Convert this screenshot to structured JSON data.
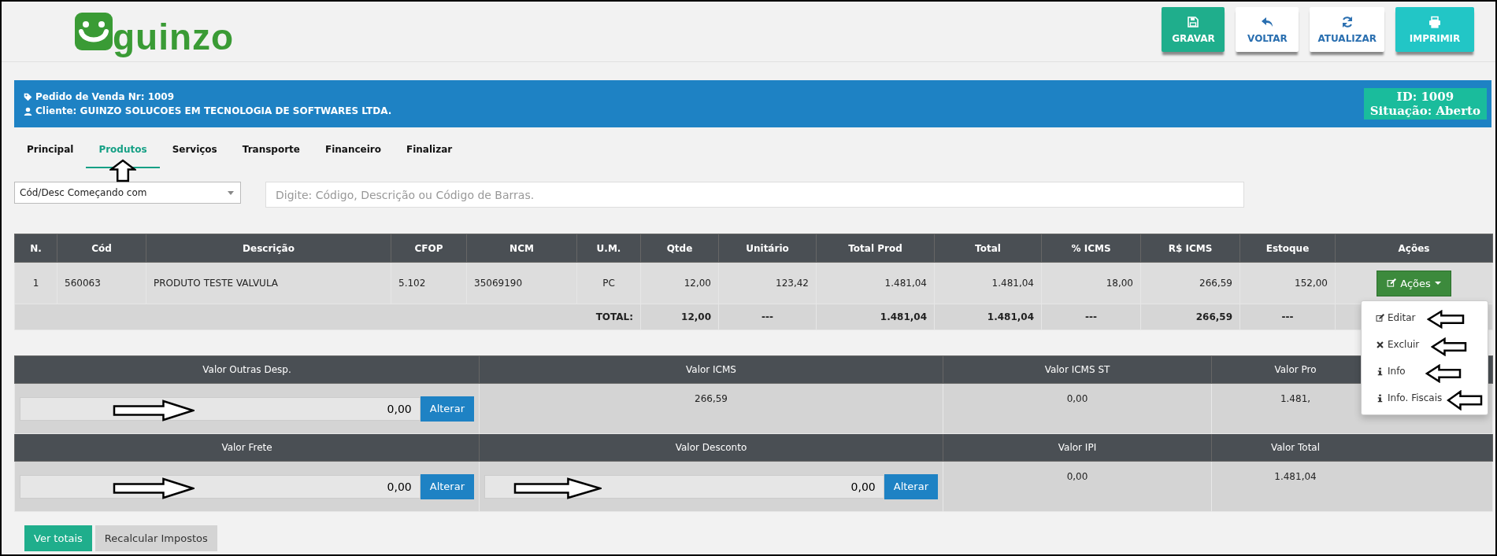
{
  "logo": {
    "text": "guinzo"
  },
  "toolbar": [
    {
      "label": "GRAVAR",
      "kind": "save"
    },
    {
      "label": "VOLTAR",
      "kind": "back"
    },
    {
      "label": "ATUALIZAR",
      "kind": "refresh"
    },
    {
      "label": "IMPRIMIR",
      "kind": "print"
    }
  ],
  "order_bar": {
    "title": "Pedido de Venda Nr: 1009",
    "client": "Cliente: GUINZO SOLUCOES EM TECNOLOGIA DE SOFTWARES LTDA.",
    "id": "ID: 1009",
    "status": "Situação: Aberto"
  },
  "tabs": [
    {
      "label": "Principal",
      "selected": false
    },
    {
      "label": "Produtos",
      "selected": true
    },
    {
      "label": "Serviços",
      "selected": false
    },
    {
      "label": "Transporte",
      "selected": false
    },
    {
      "label": "Financeiro",
      "selected": false
    },
    {
      "label": "Finalizar",
      "selected": false
    }
  ],
  "search": {
    "filter": "Cód/Desc Começando com",
    "placeholder": "Digite: Código, Descrição ou Código de Barras."
  },
  "table": {
    "columns": [
      "N.",
      "Cód",
      "Descrição",
      "CFOP",
      "NCM",
      "U.M.",
      "Qtde",
      "Unitário",
      "Total Prod",
      "Total",
      "% ICMS",
      "R$ ICMS",
      "Estoque",
      "Ações"
    ],
    "rows": [
      {
        "cells": [
          "1",
          "560063",
          "PRODUTO TESTE VALVULA",
          "5.102",
          "35069190",
          "PC",
          "12,00",
          "123,42",
          "1.481,04",
          "1.481,04",
          "18,00",
          "266,59",
          "152,00"
        ],
        "action": "Ações"
      }
    ],
    "totals": {
      "label": "TOTAL:",
      "cells": [
        "12,00",
        "---",
        "1.481,04",
        "1.481,04",
        "---",
        "266,59",
        "---"
      ]
    }
  },
  "action_menu": {
    "items": [
      {
        "label": "Editar",
        "kind": "edit"
      },
      {
        "label": "Excluir",
        "kind": "delete"
      },
      {
        "label": "Info",
        "kind": "info"
      },
      {
        "label": "Info. Fiscais",
        "kind": "info"
      }
    ]
  },
  "summary": [
    [
      {
        "label": "Valor Outras Desp.",
        "value": "0,00",
        "kind": "editable",
        "button": "Alterar"
      },
      {
        "label": "Valor ICMS",
        "value": "266,59",
        "kind": "display"
      },
      {
        "label": "Valor ICMS ST",
        "value": "0,00",
        "kind": "display"
      },
      {
        "label": "Valor Pro",
        "value": "1.481,",
        "kind": "display"
      }
    ],
    [
      {
        "label": "Valor Frete",
        "value": "0,00",
        "kind": "editable",
        "button": "Alterar"
      },
      {
        "label": "Valor Desconto",
        "value": "0,00",
        "kind": "editable",
        "button": "Alterar"
      },
      {
        "label": "Valor IPI",
        "value": "0,00",
        "kind": "display"
      },
      {
        "label": "Valor Total",
        "value": "1.481,04",
        "kind": "display"
      }
    ]
  ],
  "footer_buttons": [
    {
      "label": "Ver totais",
      "kind": "totals"
    },
    {
      "label": "Recalcular Impostos",
      "kind": "recalculate"
    }
  ]
}
